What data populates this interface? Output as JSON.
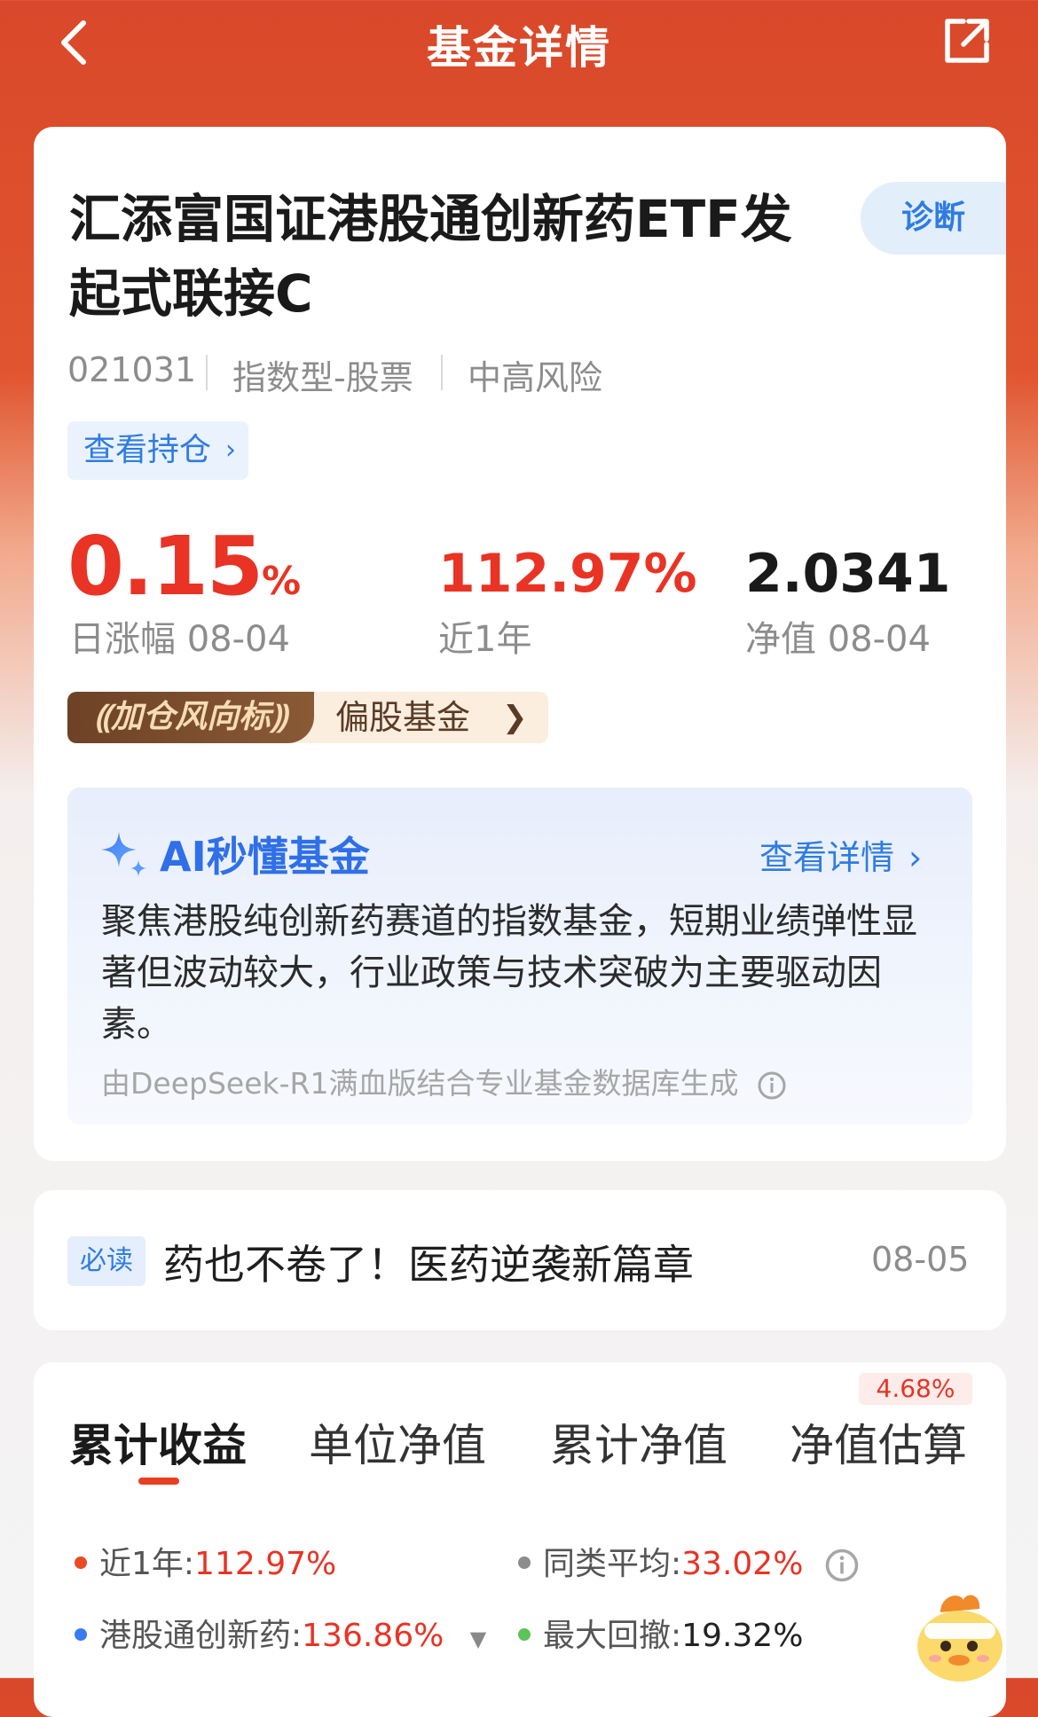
{
  "header": {
    "title": "基金详情"
  },
  "fund": {
    "name_line1": "汇添富国证港股通创新药ETF发",
    "name_line2": "起式联接C",
    "diagnose_label": "诊断",
    "code": "021031",
    "type": "指数型-股票",
    "risk": "中高风险",
    "holdings_label": "查看持仓",
    "daily_change": "0.15",
    "daily_change_unit": "%",
    "daily_change_label": "日涨幅 08-04",
    "year_return": "112.97%",
    "year_return_label": "近1年",
    "nav": "2.0341",
    "nav_label": "净值 08-04",
    "wind_tag": "加仓风向标",
    "wind_category": "偏股基金"
  },
  "ai": {
    "title": "AI秒懂基金",
    "detail_link": "查看详情",
    "summary_line1": "聚焦港股纯创新药赛道的指数基金，短期业绩弹性显",
    "summary_line2": "著但波动较大，行业政策与技术突破为主要驱动因",
    "summary_line3": "素。",
    "source": "由DeepSeek-R1满血版结合专业基金数据库生成"
  },
  "news": {
    "tag": "必读",
    "title": "药也不卷了！医药逆袭新篇章",
    "date": "08-05"
  },
  "tabs": {
    "items": [
      "累计收益",
      "单位净值",
      "累计净值",
      "净值估算"
    ],
    "active_index": 0,
    "estimate_badge": "4.68%"
  },
  "legend": {
    "year_label": "近1年:",
    "year_value": "112.97%",
    "peer_label": "同类平均:",
    "peer_value": "33.02%",
    "index_label": "港股通创新药:",
    "index_value": "136.86%",
    "drawdown_label": "最大回撤:",
    "drawdown_value": "19.32%"
  },
  "colors": {
    "accent_red": "#e93324",
    "link_blue": "#2f7ce0",
    "header_orange": "#d9482a"
  }
}
